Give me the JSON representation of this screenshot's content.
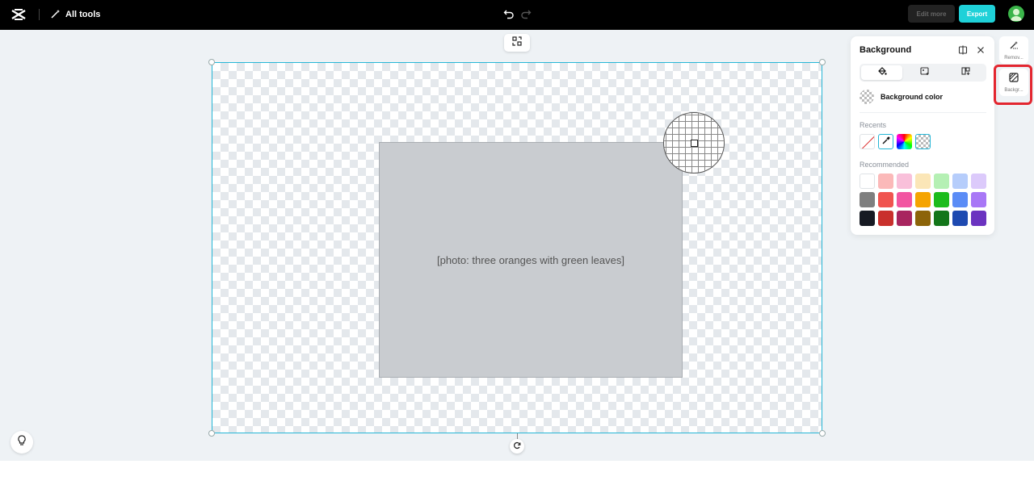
{
  "topbar": {
    "all_tools_label": "All tools",
    "edit_more_label": "Edit more",
    "export_label": "Export"
  },
  "canvas": {
    "image_placeholder": "[photo: three oranges with green leaves]"
  },
  "background_panel": {
    "title": "Background",
    "tabs": [
      "color-fill-icon",
      "image-icon",
      "template-icon"
    ],
    "active_tab": 0,
    "background_color_label": "Background color",
    "recents_label": "Recents",
    "recommended_label": "Recommended",
    "recommended_colors": [
      [
        "#ffffff",
        "#fbb9b9",
        "#f9c0da",
        "#fbe6b7",
        "#b5f0b4",
        "#b6cdfb",
        "#dccafb"
      ],
      [
        "#7f7f7f",
        "#f0544f",
        "#f255a1",
        "#f5a400",
        "#1cbc1c",
        "#5b8cf6",
        "#a877f6"
      ],
      [
        "#171a23",
        "#c9302c",
        "#a8255f",
        "#8c6409",
        "#13761a",
        "#1e4ab1",
        "#6b33c0"
      ]
    ]
  },
  "right_rail": {
    "remove_label": "Remov...",
    "background_label": "Backgr..."
  },
  "colors": {
    "accent": "#1fd1d8",
    "selection": "#25b6d6",
    "highlight": "#e3262f"
  }
}
